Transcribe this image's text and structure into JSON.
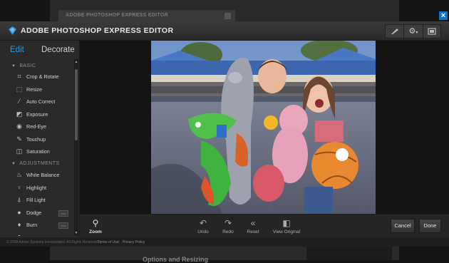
{
  "background": {
    "tab_title": "ADOBE PHOTOSHOP EXPRESS EDITOR",
    "bottom_text": "Options and Resizing"
  },
  "window": {
    "title": "ADOBE PHOTOSHOP EXPRESS EDITOR",
    "close_glyph": "×"
  },
  "tabs": {
    "edit": "Edit",
    "decorate": "Decorate"
  },
  "sections": {
    "basic": "BASIC",
    "adjustments": "ADJUSTMENTS"
  },
  "basic_tools": [
    {
      "label": "Crop & Rotate",
      "icon": "crop-icon"
    },
    {
      "label": "Resize",
      "icon": "resize-icon"
    },
    {
      "label": "Auto Correct",
      "icon": "wand-icon"
    },
    {
      "label": "Exposure",
      "icon": "exposure-icon"
    },
    {
      "label": "Red-Eye",
      "icon": "eye-icon"
    },
    {
      "label": "Touchup",
      "icon": "touchup-icon"
    },
    {
      "label": "Saturation",
      "icon": "saturation-icon"
    }
  ],
  "adjustment_tools": [
    {
      "label": "White Balance",
      "icon": "white-balance-icon"
    },
    {
      "label": "Highlight",
      "icon": "highlight-icon"
    },
    {
      "label": "Fill Light",
      "icon": "fill-light-icon"
    },
    {
      "label": "Dodge",
      "icon": "dodge-icon"
    },
    {
      "label": "Burn",
      "icon": "burn-icon"
    }
  ],
  "bottom_bar": {
    "zoom": "Zoom",
    "undo": "Undo",
    "redo": "Redo",
    "reset": "Reset",
    "view_original": "View Original",
    "cancel": "Cancel",
    "done": "Done"
  },
  "footer": {
    "copyright": "© 2008 Adobe Systems Incorporated. All Rights Reserved.",
    "terms": "Terms of Use",
    "privacy": "Privacy Policy",
    "sep": "|"
  },
  "colors": {
    "accent": "#2b9be8",
    "close": "#0a73c9"
  }
}
